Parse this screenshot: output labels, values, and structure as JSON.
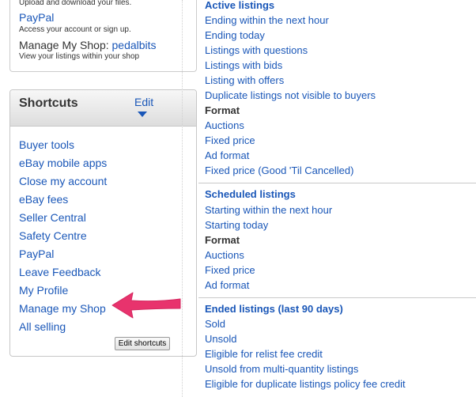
{
  "top_box": {
    "upload_text": "Upload and download your files.",
    "paypal_link": "PayPal",
    "paypal_desc": "Access your account or sign up.",
    "manage_label": "Manage My Shop:",
    "shop_name": "pedalbits",
    "manage_desc": "View your listings within your shop"
  },
  "shortcuts": {
    "title": "Shortcuts",
    "edit_label": "Edit",
    "items": [
      "Buyer tools",
      "eBay mobile apps",
      "Close my account",
      "eBay fees",
      "Seller Central",
      "Safety Centre",
      "PayPal",
      "Leave Feedback",
      "My Profile",
      "Manage my Shop",
      "All selling"
    ],
    "edit_button": "Edit shortcuts"
  },
  "active": {
    "heading": "Active listings",
    "items": [
      "Ending within the next hour",
      "Ending today",
      "Listings with questions",
      "Listings with bids",
      "Listing with offers",
      "Duplicate listings not visible to buyers"
    ],
    "format_label": "Format",
    "format_items": [
      "Auctions",
      "Fixed price",
      "Ad format",
      "Fixed price (Good 'Til Cancelled)"
    ]
  },
  "scheduled": {
    "heading": "Scheduled listings",
    "items": [
      "Starting within the next hour",
      "Starting today"
    ],
    "format_label": "Format",
    "format_items": [
      "Auctions",
      "Fixed price",
      "Ad format"
    ]
  },
  "ended": {
    "heading": "Ended listings (last 90 days)",
    "items": [
      "Sold",
      "Unsold",
      "Eligible for relist fee credit",
      "Unsold from multi-quantity listings",
      "Eligible for duplicate listings policy fee credit"
    ]
  },
  "colors": {
    "link": "#1a57b8",
    "arrow": "#e8336d"
  },
  "icons": {
    "edit_caret": "chevron-down-icon",
    "pointer": "annotation-arrow-icon"
  }
}
